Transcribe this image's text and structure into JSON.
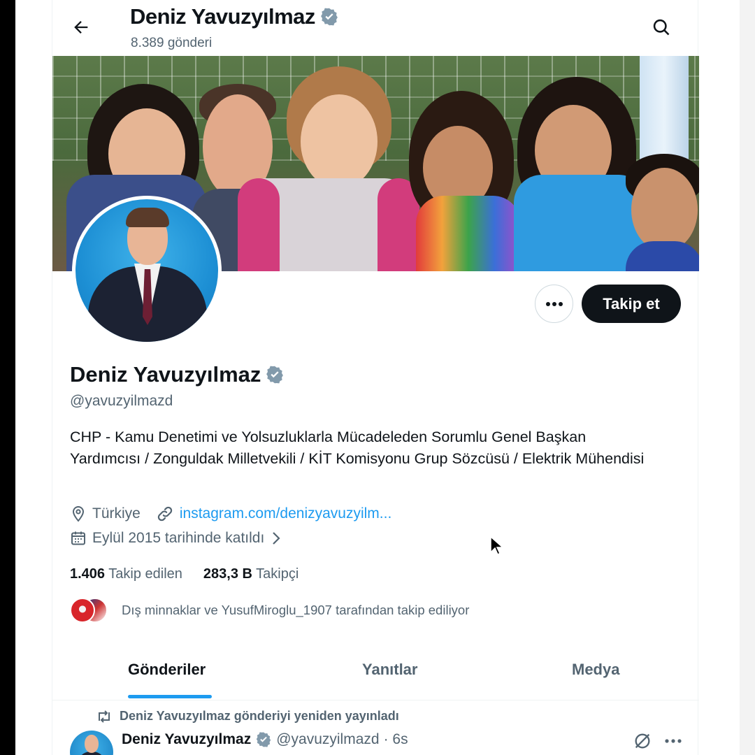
{
  "header": {
    "title": "Deniz Yavuzyılmaz",
    "post_count": "8.389 gönderi"
  },
  "profile": {
    "display_name": "Deniz Yavuzyılmaz",
    "handle": "@yavuzyilmazd",
    "bio": "CHP - Kamu Denetimi ve Yolsuzluklarla Mücadeleden Sorumlu Genel Başkan Yardımcısı / Zonguldak Milletvekili / KİT Komisyonu Grup Sözcüsü / Elektrik Mühendisi",
    "location": "Türkiye",
    "website": "instagram.com/denizyavuzyilm...",
    "joined": "Eylül 2015 tarihinde katıldı",
    "following_count": "1.406",
    "following_label": "Takip edilen",
    "followers_count": "283,3 B",
    "followers_label": "Takipçi",
    "followed_by": "Dış minnaklar ve YusufMiroglu_1907 tarafından takip ediliyor"
  },
  "actions": {
    "follow_label": "Takip et"
  },
  "tabs": [
    {
      "label": "Gönderiler",
      "active": true
    },
    {
      "label": "Yanıtlar",
      "active": false
    },
    {
      "label": "Medya",
      "active": false
    }
  ],
  "post": {
    "repost_text": "Deniz Yavuzyılmaz gönderiyi yeniden yayınladı",
    "author": "Deniz Yavuzyılmaz",
    "handle": "@yavuzyilmazd",
    "time": "· 6s"
  },
  "colors": {
    "accent": "#1d9bf0",
    "verified": "#829aab",
    "text": "#0f1419",
    "secondary": "#536471"
  }
}
